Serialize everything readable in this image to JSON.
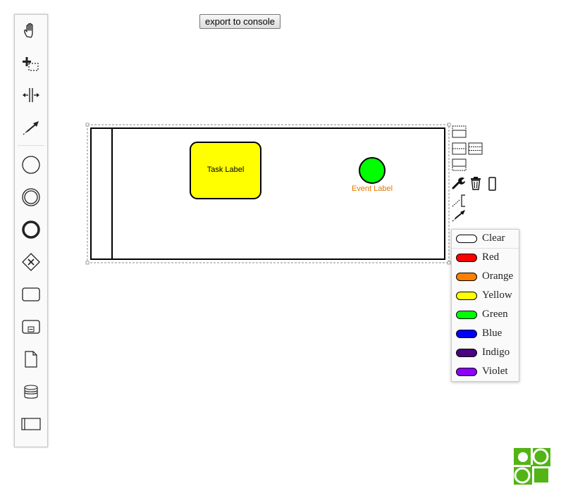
{
  "toolbar": {
    "export_label": "export to console"
  },
  "palette": {
    "tools": [
      {
        "name": "hand-tool-icon"
      },
      {
        "name": "lasso-tool-icon"
      },
      {
        "name": "space-tool-icon"
      },
      {
        "name": "global-connect-tool-icon"
      },
      {
        "name": "start-event-icon"
      },
      {
        "name": "intermediate-event-icon"
      },
      {
        "name": "end-event-icon"
      },
      {
        "name": "exclusive-gateway-icon"
      },
      {
        "name": "task-icon"
      },
      {
        "name": "subprocess-icon"
      },
      {
        "name": "data-object-icon"
      },
      {
        "name": "data-store-icon"
      },
      {
        "name": "participant-icon"
      }
    ]
  },
  "diagram": {
    "task": {
      "label": "Task Label",
      "fill": "#ffff00"
    },
    "event": {
      "label": "Event Label",
      "fill": "#00ff00",
      "label_color": "#e07800"
    }
  },
  "color_menu": {
    "items": [
      {
        "label": "Clear",
        "color": "#ffffff"
      },
      {
        "label": "Red",
        "color": "#ff0000"
      },
      {
        "label": "Orange",
        "color": "#ff7f00"
      },
      {
        "label": "Yellow",
        "color": "#ffff00"
      },
      {
        "label": "Green",
        "color": "#00ff00"
      },
      {
        "label": "Blue",
        "color": "#0000ff"
      },
      {
        "label": "Indigo",
        "color": "#4b0082"
      },
      {
        "label": "Violet",
        "color": "#8f00ff"
      }
    ]
  },
  "colors": {
    "logo": "#52b415"
  }
}
